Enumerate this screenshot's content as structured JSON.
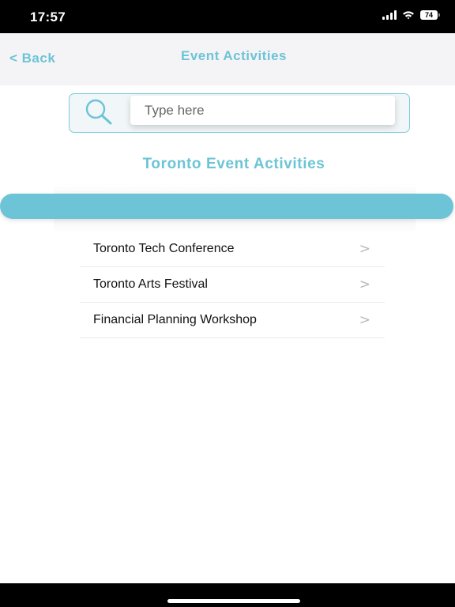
{
  "status_bar": {
    "time": "17:57",
    "battery": "74",
    "icons": [
      "signal-icon",
      "wifi-icon",
      "battery-icon"
    ]
  },
  "nav": {
    "back_label": "< Back",
    "title": "Event Activities"
  },
  "search": {
    "placeholder": "Type here",
    "value": "",
    "icon": "search-icon"
  },
  "section_title": "Toronto Event Activities",
  "events": [
    {
      "label": "Toronto Tech Conference",
      "chevron": ">"
    },
    {
      "label": "Toronto Arts Festival",
      "chevron": ">"
    },
    {
      "label": "Financial Planning Workshop",
      "chevron": ">"
    }
  ],
  "colors": {
    "accent": "#6cc4d6",
    "nav_background": "#f4f4f6",
    "status_bar": "#000000"
  }
}
